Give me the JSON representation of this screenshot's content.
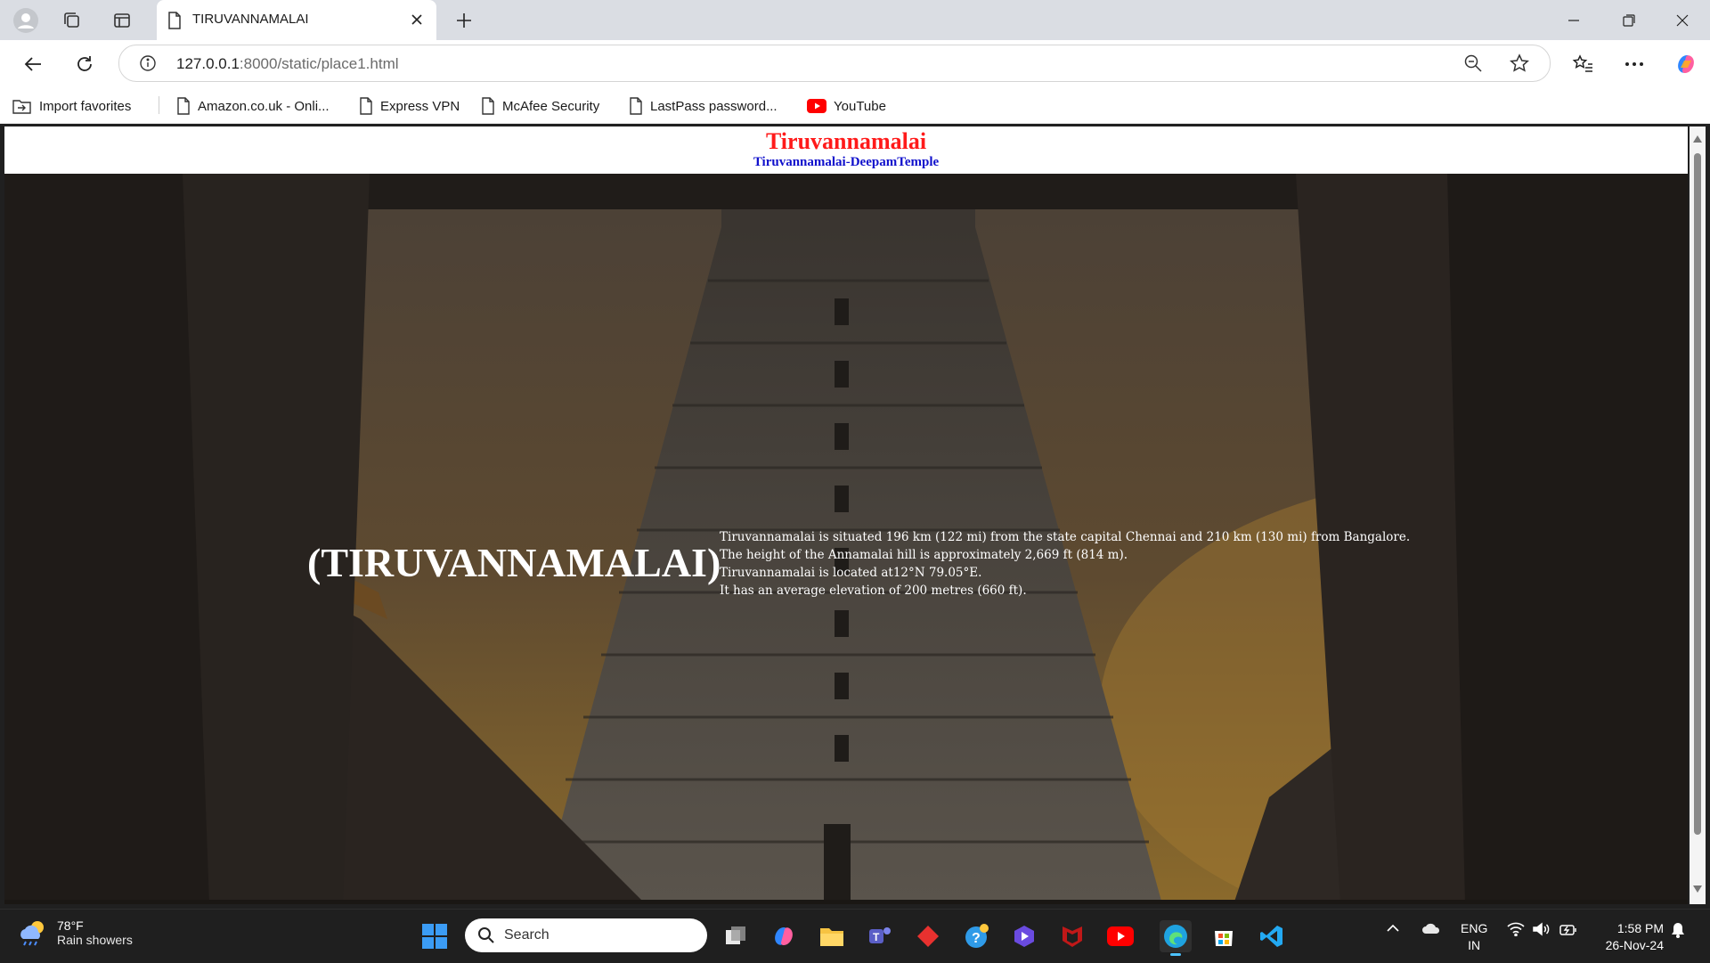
{
  "browser": {
    "tab_title": "TIRUVANNAMALAI",
    "url_host": "127.0.0.1",
    "url_rest": ":8000/static/place1.html",
    "favorites": [
      {
        "label": "Import favorites"
      },
      {
        "label": "Amazon.co.uk - Onli..."
      },
      {
        "label": "Express VPN"
      },
      {
        "label": "McAfee Security"
      },
      {
        "label": "LastPass password..."
      },
      {
        "label": "YouTube"
      }
    ]
  },
  "page": {
    "title": "Tiruvannamalai",
    "subtitle": "Tiruvannamalai-DeepamTemple",
    "hero_heading": "(TIRUVANNAMALAI)",
    "facts": [
      "Tiruvannamalai is situated 196 km (122 mi) from the state capital Chennai and 210 km (130 mi) from Bangalore.",
      "The height of the Annamalai hill is approximately 2,669 ft (814 m).",
      "Tiruvannamalai is located at12°N 79.05°E.",
      "It has an average elevation of 200 metres (660 ft)."
    ]
  },
  "taskbar": {
    "weather_temp": "78°F",
    "weather_desc": "Rain showers",
    "search_placeholder": "Search",
    "lang_top": "ENG",
    "lang_bottom": "IN",
    "time": "1:58 PM",
    "date": "26-Nov-24"
  },
  "colors": {
    "title_red": "#ff1a1a",
    "subtitle_blue": "#1010cc",
    "edge_accent": "#4cc2ff"
  }
}
